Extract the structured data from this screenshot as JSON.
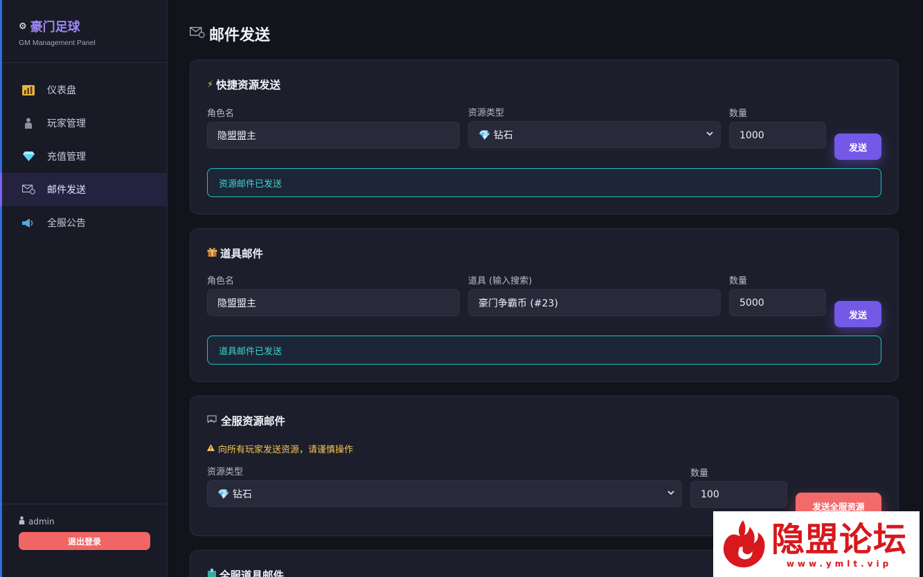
{
  "sidebar": {
    "brand": "豪门足球",
    "subtitle": "GM Management Panel",
    "items": [
      {
        "label": "仪表盘",
        "icon": "bar-chart-icon"
      },
      {
        "label": "玩家管理",
        "icon": "person-icon"
      },
      {
        "label": "充值管理",
        "icon": "diamond-icon"
      },
      {
        "label": "邮件发送",
        "icon": "mail-icon",
        "active": true
      },
      {
        "label": "全服公告",
        "icon": "megaphone-icon"
      }
    ],
    "user": "admin",
    "logout_label": "退出登录"
  },
  "page": {
    "title": "邮件发送"
  },
  "quick_resource": {
    "title": "快捷资源发送",
    "role_label": "角色名",
    "role_value": "隐盟盟主",
    "type_label": "资源类型",
    "type_value": "💎 钻石",
    "qty_label": "数量",
    "qty_value": "1000",
    "send_label": "发送",
    "alert": "资源邮件已发送"
  },
  "item_mail": {
    "title": "道具邮件",
    "role_label": "角色名",
    "role_value": "隐盟盟主",
    "item_label": "道具 (输入搜索)",
    "item_value": "豪门争霸币 (#23)",
    "qty_label": "数量",
    "qty_value": "5000",
    "send_label": "发送",
    "alert": "道具邮件已发送"
  },
  "server_resource": {
    "title": "全服资源邮件",
    "warning": "向所有玩家发送资源，请谨慎操作",
    "type_label": "资源类型",
    "type_value": "💎 钻石",
    "qty_label": "数量",
    "qty_value": "100",
    "send_label": "发送全服资源"
  },
  "server_item": {
    "title": "全服道具邮件"
  },
  "watermark": {
    "text": "隐盟论坛",
    "url": "www.ymlt.vip"
  },
  "colors": {
    "accent": "#7359e6",
    "danger": "#f36a6a",
    "success": "#22c4c4",
    "warning": "#f7c451",
    "brand": "#9d86f7"
  }
}
